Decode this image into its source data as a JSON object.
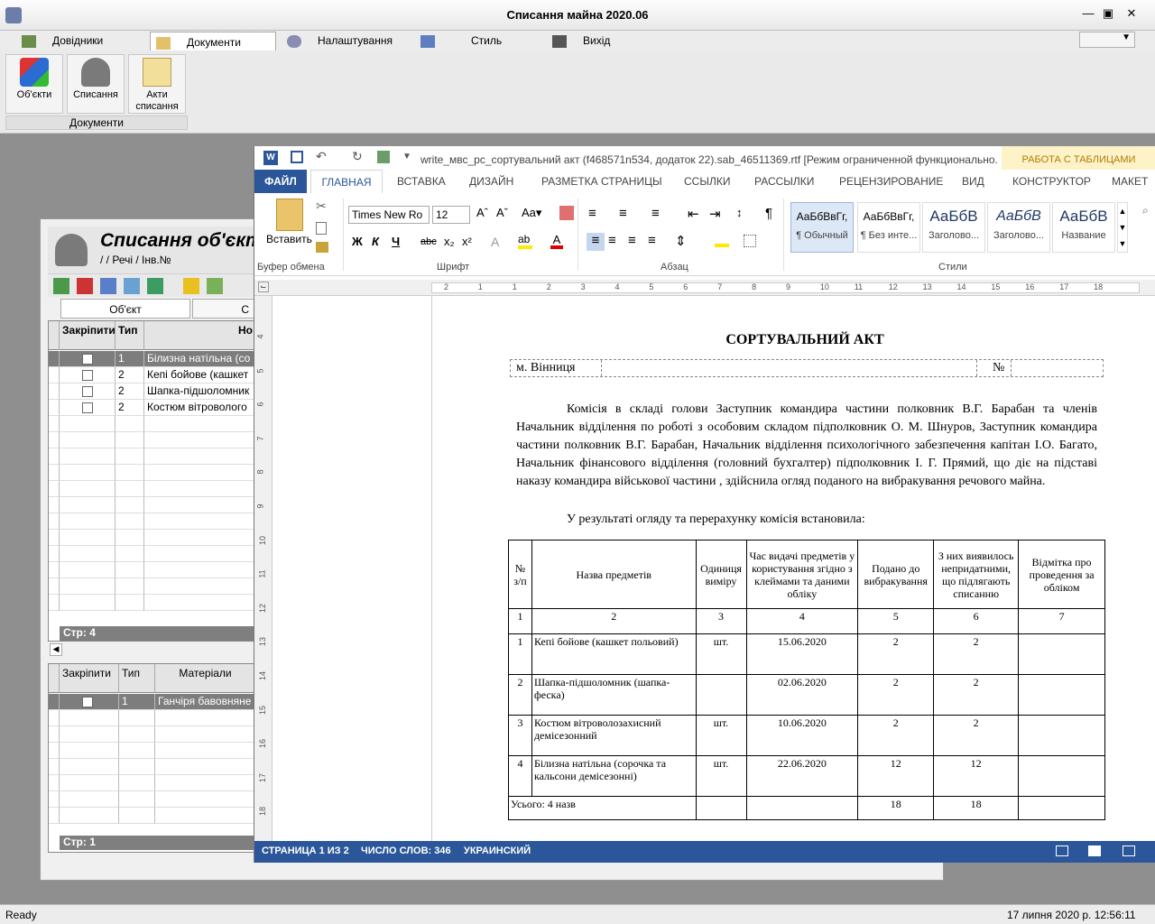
{
  "app": {
    "title": "Списання майна 2020.06"
  },
  "menu": {
    "items": [
      "Довідники",
      "Документи",
      "Налаштування",
      "Стиль",
      "Вихід"
    ]
  },
  "ribbon": {
    "buttons": [
      "Об'єкти",
      "Списання",
      "Акти списання"
    ],
    "group_label": "Документи"
  },
  "status": {
    "left": "Ready",
    "right": "17 липня 2020 р. 12:56:11"
  },
  "inner": {
    "title": "Списання об'єкт",
    "path": "/ / Речі / Інв.№",
    "tabs": [
      "Об'єкт",
      "С"
    ],
    "top_grid": {
      "headers": [
        "Закріпити",
        "Тип",
        "Но"
      ],
      "rows": [
        {
          "type": "1",
          "name": "Білизна натільна (со"
        },
        {
          "type": "2",
          "name": "Кепі бойове (кашкет"
        },
        {
          "type": "2",
          "name": "Шапка-підшоломник"
        },
        {
          "type": "2",
          "name": "Костюм вітроволого"
        }
      ],
      "footer": "Стр: 4"
    },
    "bottom_grid": {
      "headers": [
        "Закріпити",
        "Тип",
        "Матеріали"
      ],
      "rows": [
        {
          "type": "1",
          "name": "Ганчіря бавовняне"
        }
      ],
      "footer": "Стр: 1"
    }
  },
  "word": {
    "title": "write_мвс_рс_сортувальний акт (f468571n534, додаток 22).sab_46511369.rtf [Режим ограниченной функционально...",
    "context_tab": "РАБОТА С ТАБЛИЦАМИ",
    "tabs": [
      "ФАЙЛ",
      "ГЛАВНАЯ",
      "ВСТАВКА",
      "ДИЗАЙН",
      "РАЗМЕТКА СТРАНИЦЫ",
      "ССЫЛКИ",
      "РАССЫЛКИ",
      "РЕЦЕНЗИРОВАНИЕ",
      "ВИД",
      "КОНСТРУКТОР",
      "МАКЕТ"
    ],
    "font": "Times New Ro",
    "size": "12",
    "paste_label": "Вставить",
    "groups": [
      "Буфер обмена",
      "Шрифт",
      "Абзац",
      "Стили"
    ],
    "styles": [
      {
        "sample": "АаБбВвГг,",
        "name": "¶ Обычный"
      },
      {
        "sample": "АаБбВвГг,",
        "name": "¶ Без инте..."
      },
      {
        "sample": "АаБбВ",
        "name": "Заголово..."
      },
      {
        "sample": "АаБбВ",
        "name": "Заголово..."
      },
      {
        "sample": "АаБбВ",
        "name": "Название"
      }
    ],
    "ruler_h": [
      "2",
      "1",
      "1",
      "2",
      "3",
      "4",
      "5",
      "6",
      "7",
      "8",
      "9",
      "10",
      "11",
      "12",
      "13",
      "14",
      "15",
      "16",
      "17",
      "18"
    ],
    "ruler_v": [
      "4",
      "5",
      "6",
      "7",
      "8",
      "9",
      "10",
      "11",
      "12",
      "13",
      "14",
      "15",
      "16",
      "17",
      "18"
    ],
    "status": [
      "СТРАНИЦА 1 ИЗ 2",
      "ЧИСЛО СЛОВ: 346",
      "УКРАИНСКИЙ"
    ]
  },
  "doc": {
    "heading": "СОРТУВАЛЬНИЙ АКТ",
    "city": "м. Вінниця",
    "num": "№",
    "para1": "Комісія в складі голови Заступник командира частини полковник В.Г. Барабан та членів Начальник відділення по роботі з особовим складом підполковник О. М. Шнуров, Заступник командира частини полковник В.Г. Барабан, Начальник відділення психологічного забезпечення капітан І.О. Багато, Начальник фінансового відділення (головний бухгалтер) підполковник І. Г. Прямий, що діє на підставі наказу командира військової частини , здійснила огляд поданого на вибракування речового майна.",
    "para2": "У результаті огляду та перерахунку комісія встановила:",
    "table": {
      "headers": [
        "№ з/п",
        "Назва предметів",
        "Одиниця виміру",
        "Час видачі предметів у користування згідно з клеймами та даними обліку",
        "Подано до вибракування",
        "З них виявилось непридатними, що підлягають списанню",
        "Відмітка про проведення за обліком"
      ],
      "nums": [
        "1",
        "2",
        "3",
        "4",
        "5",
        "6",
        "7"
      ],
      "rows": [
        [
          "1",
          "Кепі бойове (кашкет польовий)",
          "шт.",
          "15.06.2020",
          "2",
          "2",
          ""
        ],
        [
          "2",
          "Шапка-підшоломник (шапка-феска)",
          "",
          "02.06.2020",
          "2",
          "2",
          ""
        ],
        [
          "3",
          "Костюм вітроволозахисний демісезонний",
          "шт.",
          "10.06.2020",
          "2",
          "2",
          ""
        ],
        [
          "4",
          "Білизна натільна (сорочка та кальсони демісезонні)",
          "шт.",
          "22.06.2020",
          "12",
          "12",
          ""
        ]
      ],
      "total": [
        "Усього: 4 назв",
        "",
        "",
        "18",
        "18",
        ""
      ]
    }
  }
}
